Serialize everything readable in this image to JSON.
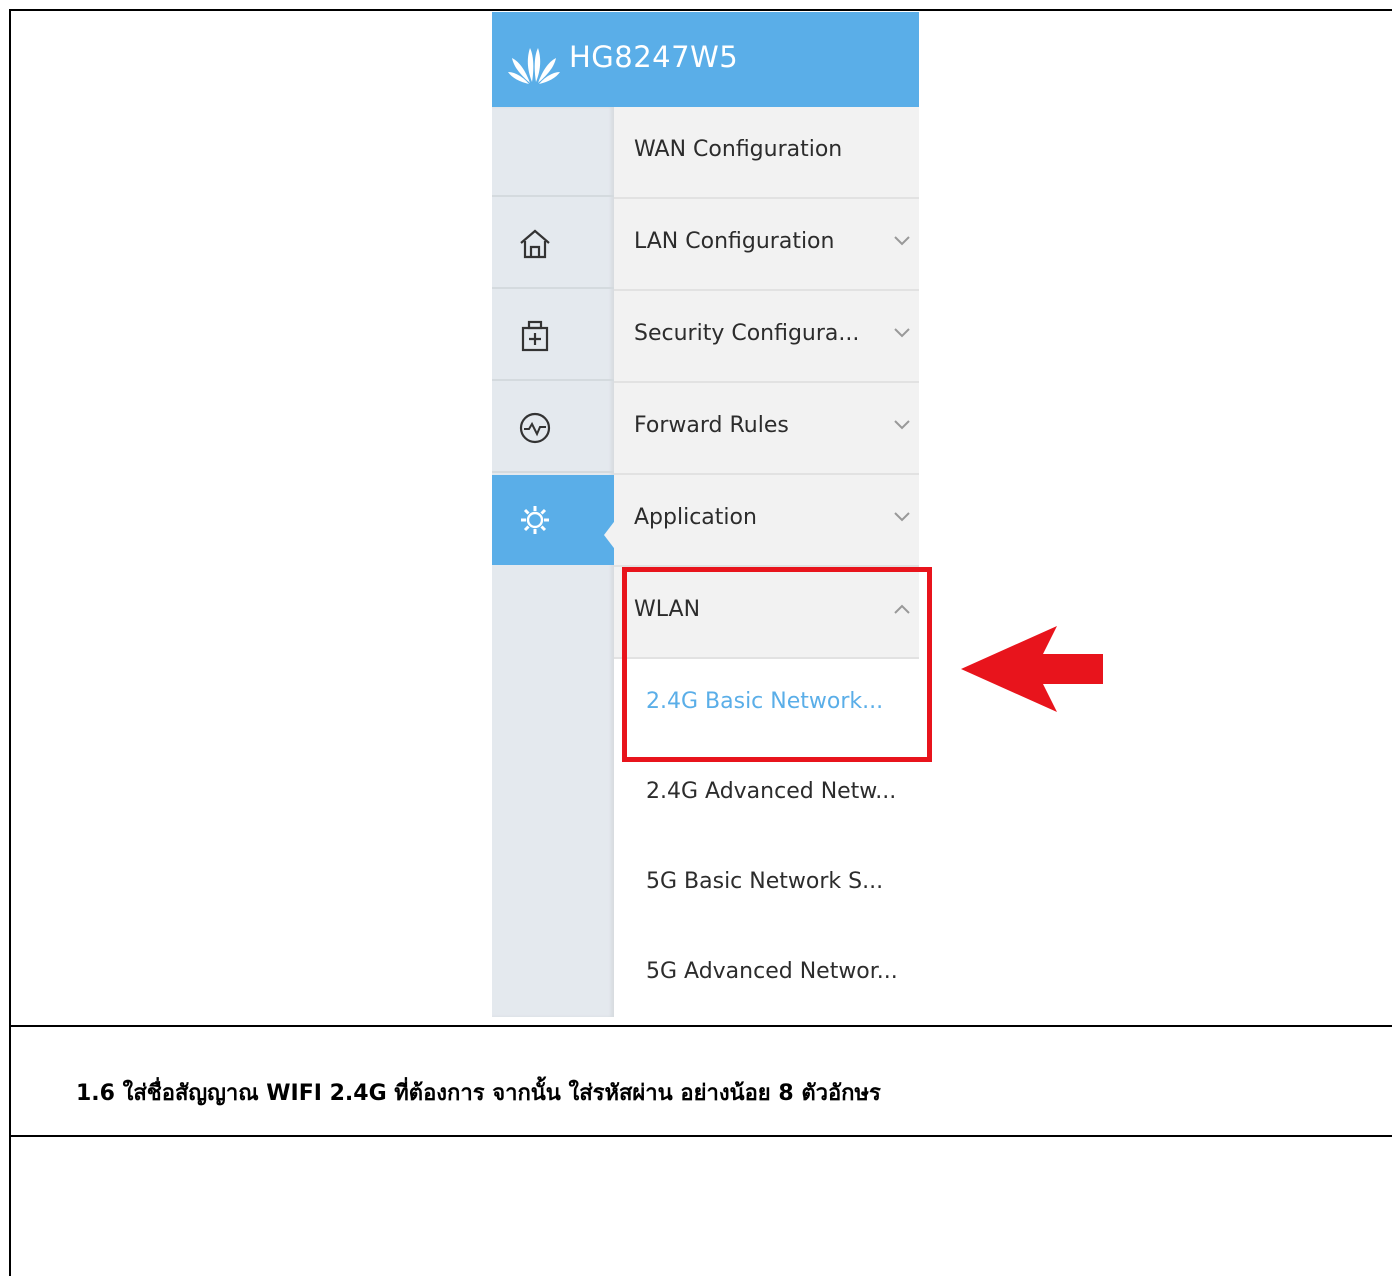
{
  "router": {
    "model": "HG8247W5",
    "rail_icons": [
      "home-icon",
      "first-aid-kit-icon",
      "pulse-icon",
      "gear-icon"
    ],
    "menu": [
      {
        "label": "WAN Configuration",
        "has_chevron": false
      },
      {
        "label": "LAN Configuration",
        "has_chevron": true
      },
      {
        "label": "Security Configura...",
        "has_chevron": true
      },
      {
        "label": "Forward Rules",
        "has_chevron": true
      },
      {
        "label": "Application",
        "has_chevron": true
      },
      {
        "label": "WLAN",
        "expanded": true
      }
    ],
    "wlan_submenu": [
      {
        "label": "2.4G Basic Network...",
        "selected": true
      },
      {
        "label": "2.4G Advanced Netw..."
      },
      {
        "label": "5G Basic Network S..."
      },
      {
        "label": "5G Advanced Networ..."
      }
    ],
    "colors": {
      "accent": "#5aaee8",
      "highlight": "#e8141c"
    }
  },
  "caption": "1.6 ใส่ชื่อสัญญาณ WIFI 2.4G ที่ต้องการ จากนั้น ใส่รหัสผ่าน อย่างน้อย 8 ตัวอักษร"
}
